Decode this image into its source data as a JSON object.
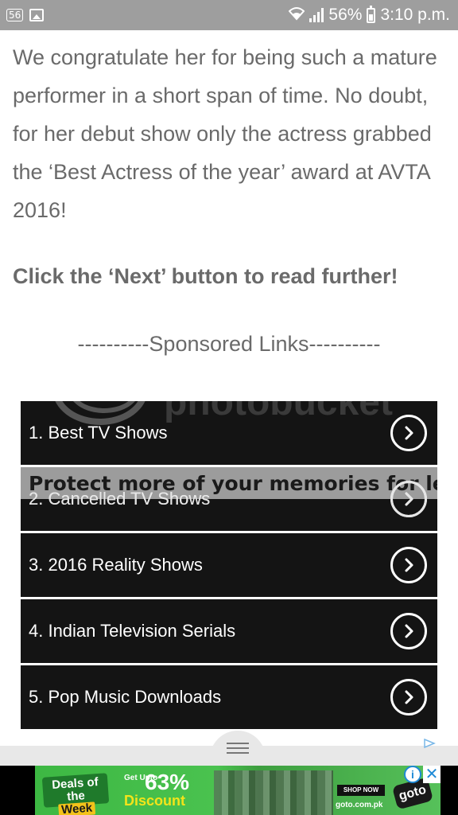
{
  "status_bar": {
    "notification_badge": "56",
    "battery_percent": "56%",
    "time": "3:10 p.m."
  },
  "article": {
    "paragraph": "We congratulate her for being such a mature performer in a short span of time. No doubt, for her debut show only the actress grabbed the ‘Best Actress of the year’ award at AVTA 2016!",
    "cta": "Click the ‘Next’ button to read further!"
  },
  "sponsored": {
    "header": "----------Sponsored Links----------"
  },
  "links": [
    {
      "label": "1.  Best TV Shows"
    },
    {
      "label": "2.  Cancelled TV Shows"
    },
    {
      "label": "3.  2016 Reality Shows"
    },
    {
      "label": "4.  Indian Television Serials"
    },
    {
      "label": "5.  Pop Music Downloads"
    }
  ],
  "overlay": {
    "brand": "photobucket",
    "banner": "Protect more of your memories for less!"
  },
  "ad": {
    "deals_line1": "Deals of the",
    "deals_line2": "Week",
    "upto": "Get Upto",
    "percent": "63%",
    "discount": "Discount",
    "shop_now": "SHOP NOW",
    "url": "goto.com.pk",
    "logo": "goto",
    "info_icon": "i",
    "close_icon": "✕"
  }
}
